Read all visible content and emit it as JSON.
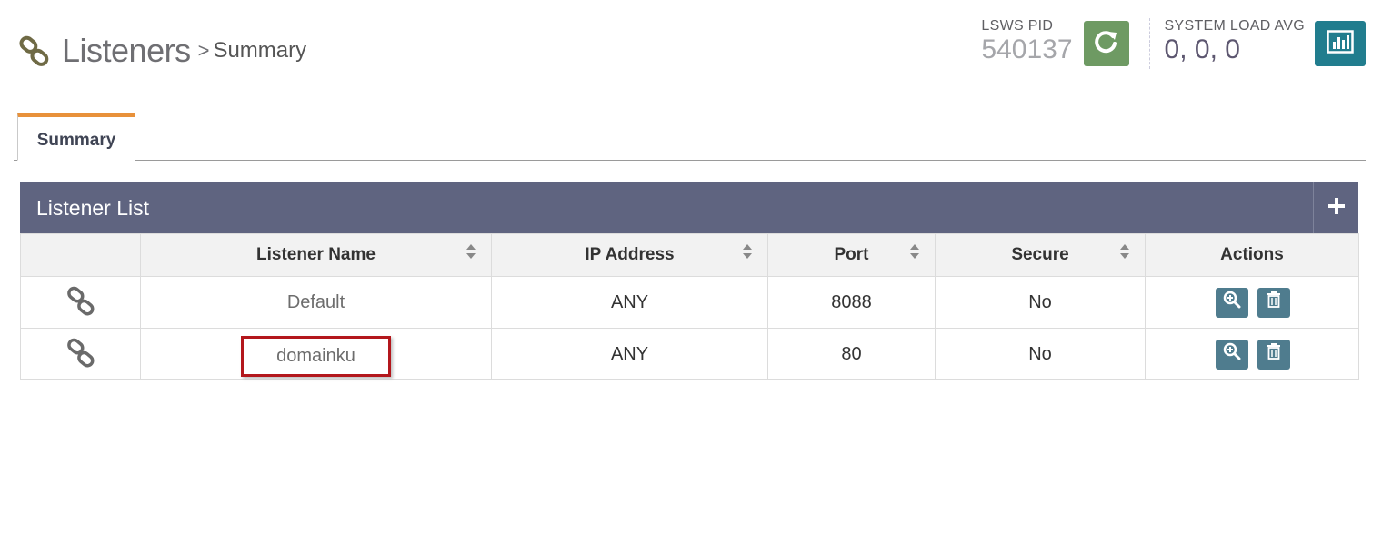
{
  "header": {
    "title": "Listeners",
    "separator": ">",
    "breadcrumb": "Summary"
  },
  "stats": {
    "pid_label": "LSWS PID",
    "pid_value": "540137",
    "load_label": "SYSTEM LOAD AVG",
    "load_value": "0, 0, 0"
  },
  "tabs": [
    {
      "label": "Summary",
      "active": true
    }
  ],
  "panel": {
    "title": "Listener List",
    "columns": [
      "Listener Name",
      "IP Address",
      "Port",
      "Secure",
      "Actions"
    ],
    "rows": [
      {
        "name": "Default",
        "ip": "ANY",
        "port": "8088",
        "secure": "No"
      },
      {
        "name": "domainku",
        "ip": "ANY",
        "port": "80",
        "secure": "No"
      }
    ]
  },
  "colors": {
    "panel_header": "#5f6480",
    "tab_accent": "#e8913a",
    "restart_button": "#6e9a63",
    "chart_button": "#217d8e",
    "action_button": "#4f7c8e",
    "highlight_box": "#b3171c"
  },
  "icons": {
    "page": "chain-link-icon",
    "restart": "refresh-icon",
    "load": "bar-chart-icon",
    "add": "plus-icon",
    "row": "chain-link-icon",
    "view": "zoom-in-icon",
    "delete": "trash-icon",
    "sort": "sort-icon"
  }
}
